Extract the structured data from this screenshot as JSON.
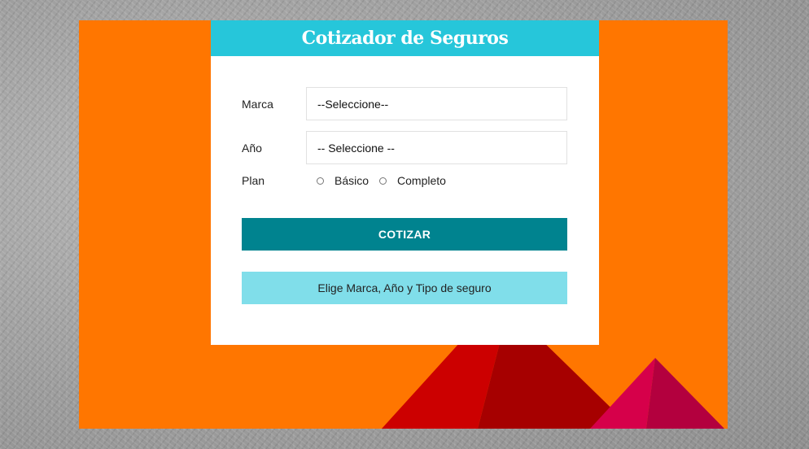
{
  "app": {
    "title": "Cotizador de Seguros"
  },
  "form": {
    "brand": {
      "label": "Marca",
      "selected": "--Seleccione--"
    },
    "year": {
      "label": "Año",
      "selected": "-- Seleccione --"
    },
    "plan": {
      "label": "Plan",
      "options": [
        "Básico",
        "Completo"
      ],
      "selected": null
    },
    "submit_label": "COTIZAR",
    "message": "Elige Marca, Año y Tipo de seguro"
  },
  "colors": {
    "background_orange": "#ff7600",
    "header_cyan": "#26c6da",
    "button_teal": "#00838f",
    "message_light_cyan": "#80deea",
    "mountain_red": "#cc0000",
    "mountain_dark_red": "#a60000",
    "mountain_pink": "#d6004a",
    "mountain_dark_pink": "#b3003e"
  }
}
